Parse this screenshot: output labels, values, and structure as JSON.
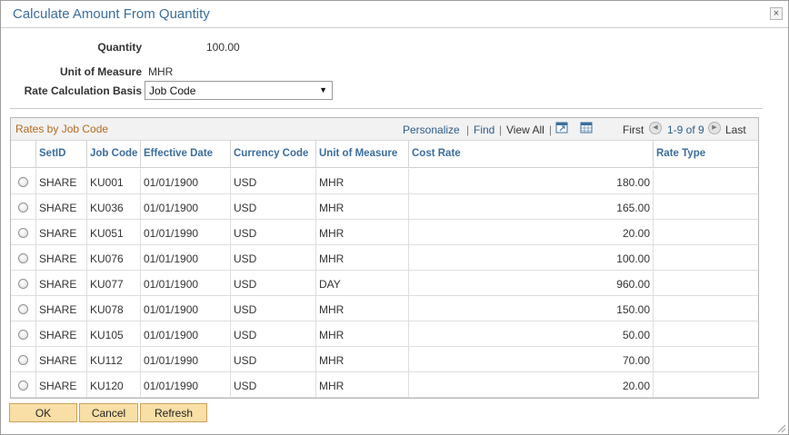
{
  "dialog": {
    "title": "Calculate Amount From Quantity",
    "close_label": "×"
  },
  "form": {
    "quantity_label": "Quantity",
    "quantity_value": "100.00",
    "uom_label": "Unit of Measure",
    "uom_value": "MHR",
    "rate_basis_label": "Rate Calculation Basis",
    "rate_basis_value": "Job Code"
  },
  "grid": {
    "title": "Rates by Job Code",
    "personalize": "Personalize",
    "find": "Find",
    "view_all": "View All",
    "first": "First",
    "range": "1-9 of 9",
    "last": "Last",
    "columns": [
      "SetID",
      "Job Code",
      "Effective Date",
      "Currency Code",
      "Unit of Measure",
      "Cost Rate",
      "Rate Type"
    ],
    "rows": [
      [
        "SHARE",
        "KU001",
        "01/01/1900",
        "USD",
        "MHR",
        "180.00",
        ""
      ],
      [
        "SHARE",
        "KU036",
        "01/01/1900",
        "USD",
        "MHR",
        "165.00",
        ""
      ],
      [
        "SHARE",
        "KU051",
        "01/01/1990",
        "USD",
        "MHR",
        "20.00",
        ""
      ],
      [
        "SHARE",
        "KU076",
        "01/01/1900",
        "USD",
        "MHR",
        "100.00",
        ""
      ],
      [
        "SHARE",
        "KU077",
        "01/01/1900",
        "USD",
        "DAY",
        "960.00",
        ""
      ],
      [
        "SHARE",
        "KU078",
        "01/01/1900",
        "USD",
        "MHR",
        "150.00",
        ""
      ],
      [
        "SHARE",
        "KU105",
        "01/01/1900",
        "USD",
        "MHR",
        "50.00",
        ""
      ],
      [
        "SHARE",
        "KU112",
        "01/01/1990",
        "USD",
        "MHR",
        "70.00",
        ""
      ],
      [
        "SHARE",
        "KU120",
        "01/01/1990",
        "USD",
        "MHR",
        "20.00",
        ""
      ]
    ]
  },
  "buttons": {
    "ok": "OK",
    "cancel": "Cancel",
    "refresh": "Refresh"
  },
  "colors": {
    "title": "#3b6e9c",
    "grid_title": "#b36b1f",
    "link": "#2d5c88",
    "button_bg": "#f9dfa6",
    "button_border": "#c9a15a"
  }
}
